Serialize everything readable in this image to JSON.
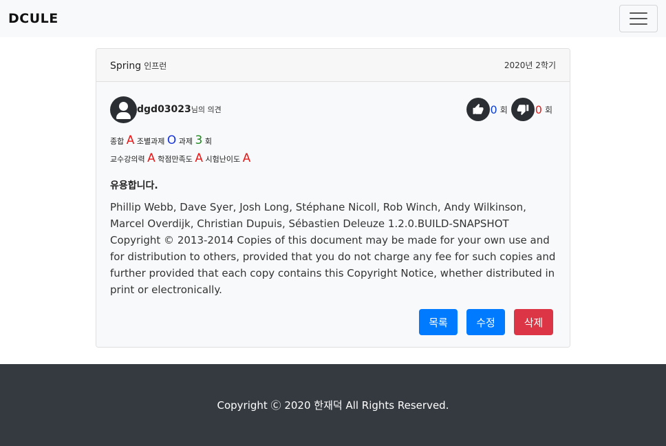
{
  "navbar": {
    "brand": "DCULE"
  },
  "card": {
    "course_name": "Spring",
    "course_sub": "인프런",
    "semester": "2020년 2학기",
    "author_id": "dgd03023",
    "author_suffix": "님의 의견",
    "likes": "0",
    "dislikes": "0",
    "vote_unit": "회",
    "grades": {
      "total_label": "종합",
      "total_value": "A",
      "team_label": "조별과제",
      "team_value": "O",
      "assign_label": "과제",
      "assign_value": "3",
      "assign_unit": "회",
      "prof_label": "교수강의력",
      "prof_value": "A",
      "credit_label": "학점만족도",
      "credit_value": "A",
      "exam_label": "시험난이도",
      "exam_value": "A"
    },
    "review_title": "유용합니다.",
    "review_text": "Phillip Webb, Dave Syer, Josh Long, Stéphane Nicoll, Rob Winch, Andy Wilkinson, Marcel Overdijk, Christian Dupuis, Sébastien Deleuze 1.2.0.BUILD-SNAPSHOT Copyright © 2013-2014 Copies of this document may be made for your own use and for distribution to others, provided that you do not charge any fee for such copies and further provided that each copy contains this Copyright Notice, whether distributed in print or electronically.",
    "buttons": {
      "list": "목록",
      "edit": "수정",
      "delete": "삭제"
    }
  },
  "colors": {
    "primary": "#007bff",
    "danger": "#dc3545",
    "footer_bg": "#343a40",
    "navbar_bg": "#f8f9fa"
  },
  "footer": {
    "copyright": "Copyright Ⓒ 2020 한재덕 All Rights Reserved."
  }
}
